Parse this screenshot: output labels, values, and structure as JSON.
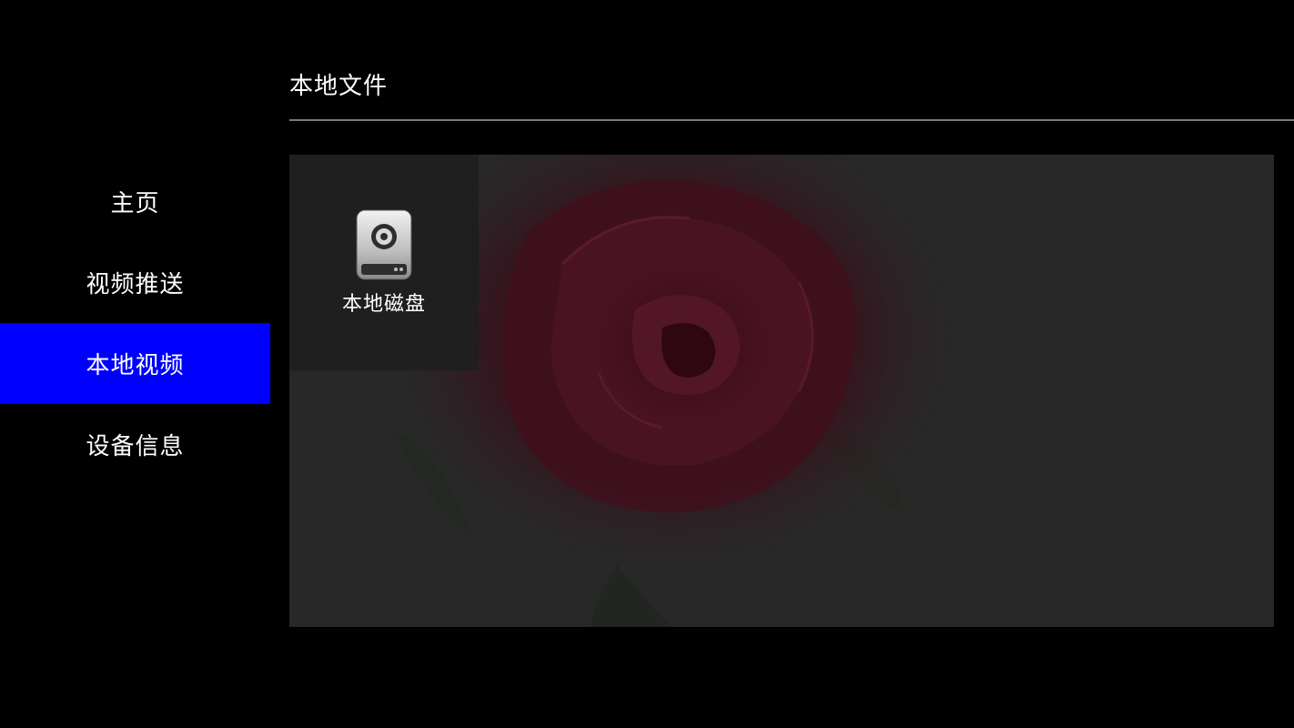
{
  "sidebar": {
    "items": [
      {
        "label": "主页",
        "active": false
      },
      {
        "label": "视频推送",
        "active": false
      },
      {
        "label": "本地视频",
        "active": true
      },
      {
        "label": "设备信息",
        "active": false
      }
    ]
  },
  "header": {
    "title": "本地文件"
  },
  "content": {
    "tiles": [
      {
        "label": "本地磁盘",
        "icon": "hard-disk-icon"
      }
    ]
  },
  "colors": {
    "background": "#000000",
    "active_nav": "#0000ff",
    "panel": "#282828",
    "divider": "#7a7a7a",
    "text": "#ffffff"
  }
}
